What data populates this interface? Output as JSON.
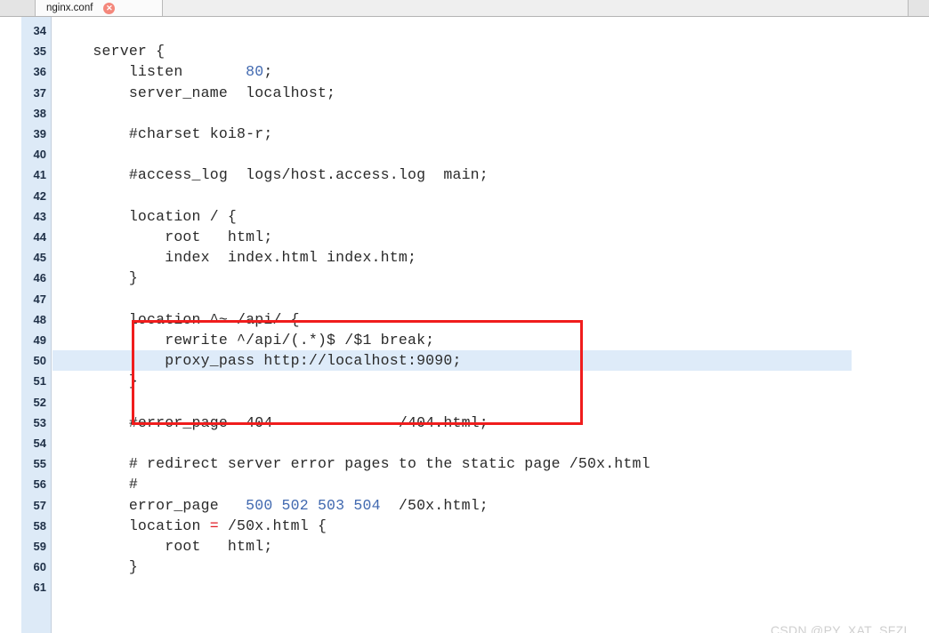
{
  "tab_bar": {
    "tabs": [
      {
        "label": "nginx.conf",
        "close_glyph": "✕",
        "active": true
      }
    ]
  },
  "editor": {
    "first_visible_line": 34,
    "highlighted_line": 50,
    "syntax_colors": {
      "text": "#2a2a2a",
      "number": "#4169b0",
      "operator": "#e01b24",
      "gutter_bg": "#ddeaf7",
      "gutter_fg": "#1f3047",
      "line_highlight": "#deebf9",
      "annotation_box": "#f01d1d"
    },
    "lines": [
      {
        "num": "34",
        "text": ""
      },
      {
        "num": "35",
        "text": "    server {"
      },
      {
        "num": "36",
        "text": "        listen       80;",
        "tokens": [
          {
            "t": "        listen       "
          },
          {
            "t": "80",
            "c": "num"
          },
          {
            "t": ";"
          }
        ]
      },
      {
        "num": "37",
        "text": "        server_name  localhost;"
      },
      {
        "num": "38",
        "text": ""
      },
      {
        "num": "39",
        "text": "        #charset koi8-r;"
      },
      {
        "num": "40",
        "text": ""
      },
      {
        "num": "41",
        "text": "        #access_log  logs/host.access.log  main;"
      },
      {
        "num": "42",
        "text": ""
      },
      {
        "num": "43",
        "text": "        location / {"
      },
      {
        "num": "44",
        "text": "            root   html;"
      },
      {
        "num": "45",
        "text": "            index  index.html index.htm;"
      },
      {
        "num": "46",
        "text": "        }"
      },
      {
        "num": "47",
        "text": ""
      },
      {
        "num": "48",
        "text": "        location ^~ /api/ {"
      },
      {
        "num": "49",
        "text": "            rewrite ^/api/(.*)$ /$1 break;"
      },
      {
        "num": "50",
        "text": "            proxy_pass http://localhost:9090;"
      },
      {
        "num": "51",
        "text": "        }"
      },
      {
        "num": "52",
        "text": ""
      },
      {
        "num": "53",
        "text": "        #error_page  404              /404.html;"
      },
      {
        "num": "54",
        "text": ""
      },
      {
        "num": "55",
        "text": "        # redirect server error pages to the static page /50x.html"
      },
      {
        "num": "56",
        "text": "        #"
      },
      {
        "num": "57",
        "text": "        error_page   500 502 503 504  /50x.html;",
        "tokens": [
          {
            "t": "        error_page   "
          },
          {
            "t": "500 502 503 504",
            "c": "num"
          },
          {
            "t": "  /50x.html;"
          }
        ]
      },
      {
        "num": "58",
        "text": "        location = /50x.html {",
        "tokens": [
          {
            "t": "        location "
          },
          {
            "t": "=",
            "c": "op"
          },
          {
            "t": " /50x.html {"
          }
        ]
      },
      {
        "num": "59",
        "text": "            root   html;"
      },
      {
        "num": "60",
        "text": "        }"
      },
      {
        "num": "61",
        "text": ""
      }
    ]
  },
  "annotation": {
    "label": "red-rectangle-around-api-location-block",
    "covers_lines": "48-51"
  },
  "watermark": {
    "text": "CSDN @PY_XAT_SFZL"
  }
}
